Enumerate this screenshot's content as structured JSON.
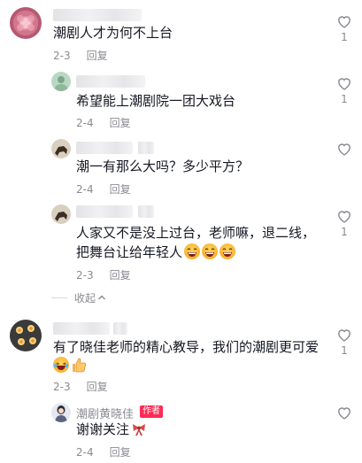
{
  "comments": [
    {
      "text": "潮剧人才为何不上台",
      "date": "2-3",
      "reply": "回复",
      "likes": "1",
      "replies": [
        {
          "text": "希望能上潮剧院一团大戏台",
          "date": "2-4",
          "reply": "回复",
          "likes": "1"
        },
        {
          "text": "潮一有那么大吗？多少平方？",
          "date": "2-4",
          "reply": "回复",
          "likes": ""
        },
        {
          "text_line1": "人家又不是没上过台，老师嘛，退二线，",
          "text_line2": "把舞台让给年轻人",
          "date": "2-3",
          "reply": "回复",
          "likes": "1"
        }
      ],
      "collapse_label": "收起"
    },
    {
      "text": "有了晓佳老师的精心教导，我们的潮剧更可爱",
      "date": "2-3",
      "reply": "回复",
      "likes": "1",
      "replies": [
        {
          "author": "潮剧黄晓佳",
          "author_badge": "作者",
          "text": "谢谢关注",
          "date": "2-4",
          "reply": "回复",
          "likes": ""
        }
      ]
    }
  ],
  "icons": {
    "like": "heart-outline-icon",
    "collapse": "chevron-up-icon"
  },
  "colors": {
    "primary_text": "#161823",
    "secondary_text": "#8a8b91",
    "heart_outline": "#8a8b91",
    "author_badge": "#fe2c55"
  }
}
